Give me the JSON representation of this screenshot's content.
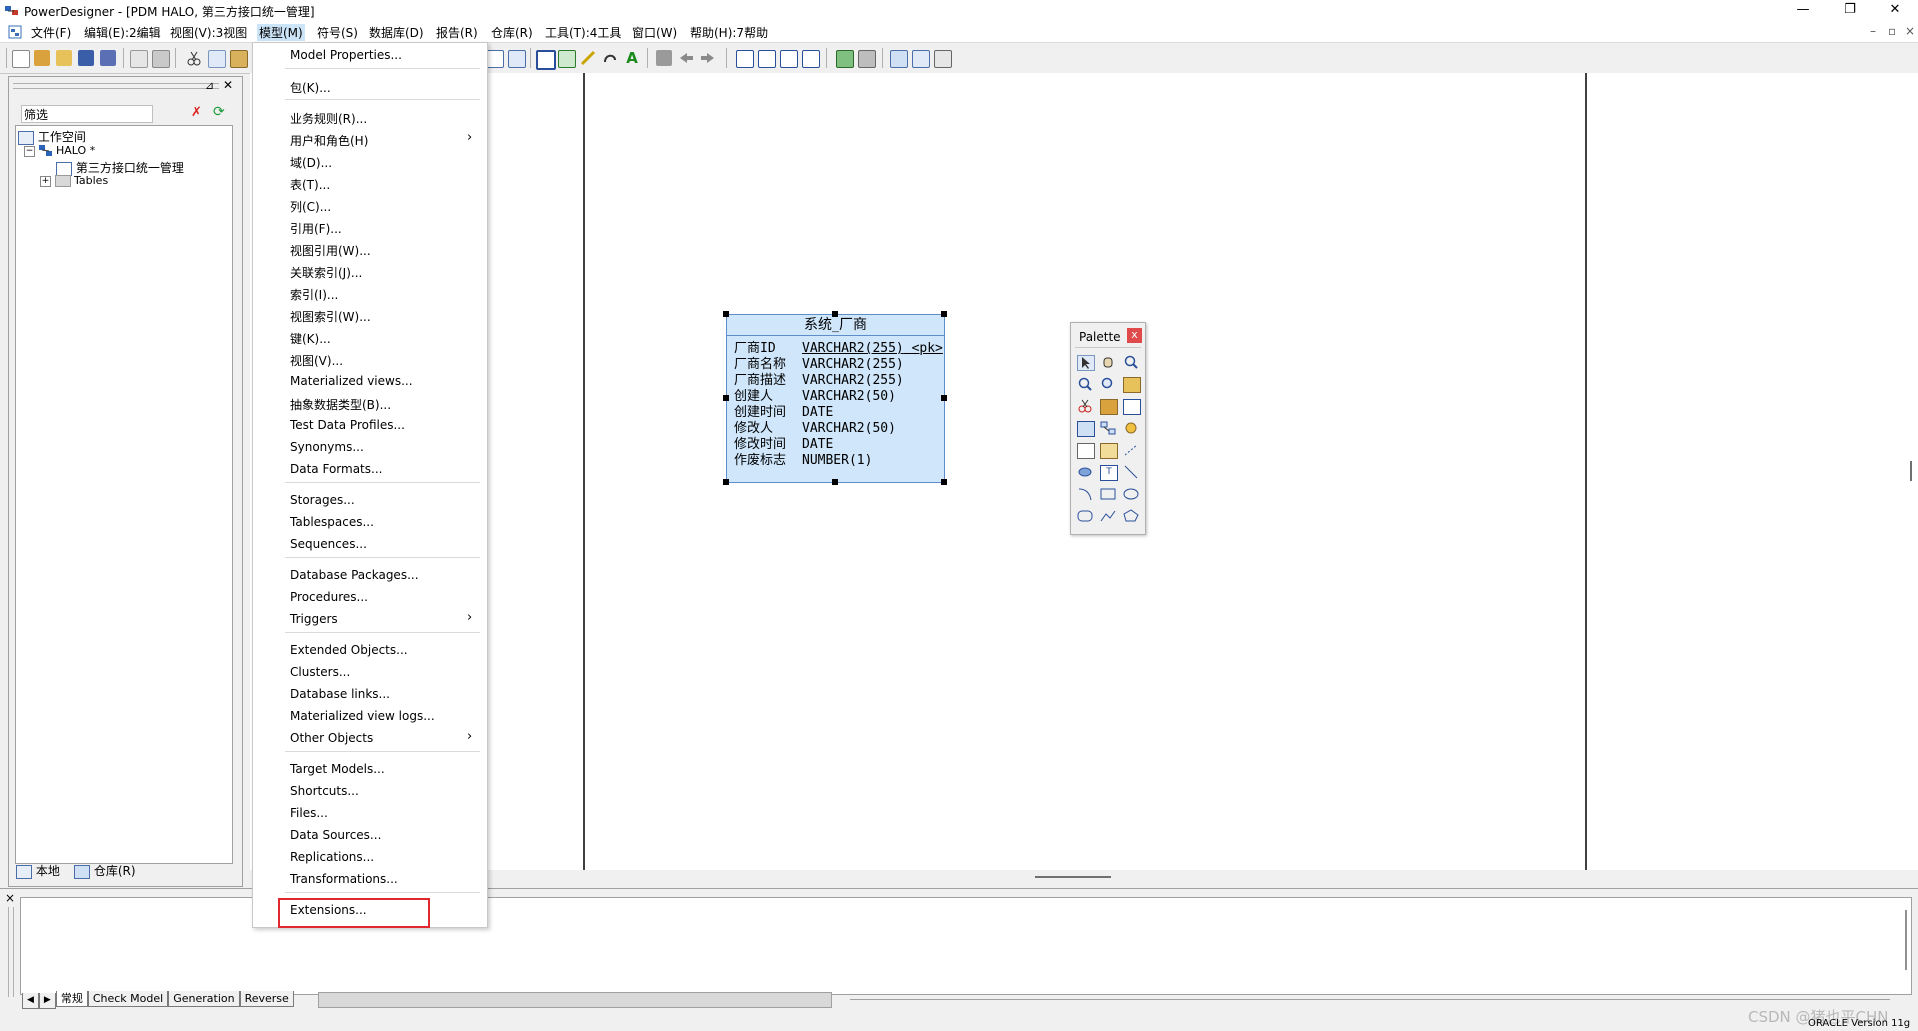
{
  "window": {
    "title": "PowerDesigner - [PDM HALO, 第三方接口统一管理]",
    "minimize_glyph": "—",
    "restore_glyph": "❐",
    "close_glyph": "✕"
  },
  "menubar": {
    "items": [
      "文件(F)",
      "编辑(E):2编辑",
      "视图(V):3视图",
      "模型(M)",
      "符号(S)",
      "数据库(D)",
      "报告(R)",
      "仓库(R)",
      "工具(T):4工具",
      "窗口(W)",
      "帮助(H):7帮助"
    ],
    "mdi_controls": [
      "–",
      "▫",
      "×"
    ]
  },
  "browser": {
    "filter_label": "筛选",
    "tree": {
      "workspace": "工作空间",
      "model": "HALO *",
      "diagram": "第三方接口统一管理",
      "folder": "Tables"
    },
    "tabs": [
      "本地",
      "仓库(R)"
    ]
  },
  "table_symbol": {
    "name": "系统_厂商",
    "columns": [
      {
        "name": "厂商ID",
        "type": "VARCHAR2(255)",
        "key": "<pk>"
      },
      {
        "name": "厂商名称",
        "type": "VARCHAR2(255)",
        "key": ""
      },
      {
        "name": "厂商描述",
        "type": "VARCHAR2(255)",
        "key": ""
      },
      {
        "name": "创建人",
        "type": "VARCHAR2(50)",
        "key": ""
      },
      {
        "name": "创建时间",
        "type": "DATE",
        "key": ""
      },
      {
        "name": "修改人",
        "type": "VARCHAR2(50)",
        "key": ""
      },
      {
        "name": "修改时间",
        "type": "DATE",
        "key": ""
      },
      {
        "name": "作废标志",
        "type": "NUMBER(1)",
        "key": ""
      }
    ]
  },
  "palette": {
    "title": "Palette",
    "close": "x"
  },
  "model_menu": {
    "items": [
      "Model Properties...",
      "包(K)...",
      "业务规则(R)...",
      "用户和角色(H)",
      "域(D)...",
      "表(T)...",
      "列(C)...",
      "引用(F)...",
      "视图引用(W)...",
      "关联索引(J)...",
      "索引(I)...",
      "视图索引(W)...",
      "键(K)...",
      "视图(V)...",
      "Materialized views...",
      "抽象数据类型(B)...",
      "Test Data Profiles...",
      "Synonyms...",
      "Data Formats...",
      "Storages...",
      "Tablespaces...",
      "Sequences...",
      "Database Packages...",
      "Procedures...",
      "Triggers",
      "Extended Objects...",
      "Clusters...",
      "Database links...",
      "Materialized view logs...",
      "Other Objects",
      "Target Models...",
      "Shortcuts...",
      "Files...",
      "Data Sources...",
      "Replications...",
      "Transformations...",
      "Extensions..."
    ],
    "submenu_arrow": "›",
    "highlighted_item": "Extensions...",
    "highlight_color": "#e0282e"
  },
  "output": {
    "close": "×",
    "tabs": [
      "常规",
      "Check Model",
      "Generation",
      "Reverse"
    ]
  },
  "statusbar": {
    "dbms": "ORACLE Version 11g",
    "watermark": "CSDN @猪也平CHN"
  }
}
